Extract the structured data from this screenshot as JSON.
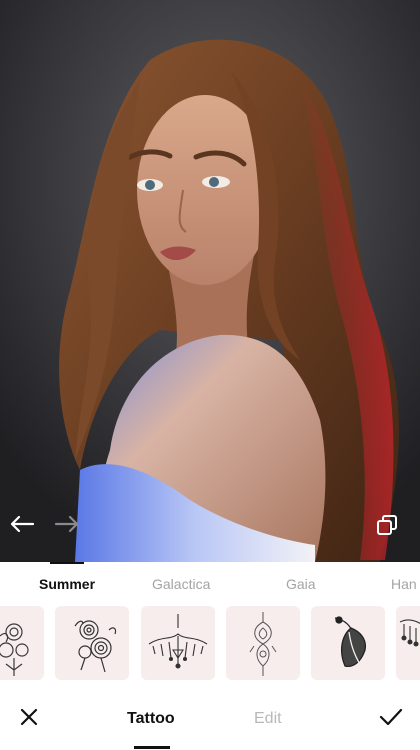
{
  "photo": {
    "undo_icon": "arrow-left-icon",
    "redo_icon": "arrow-right-icon",
    "compare_icon": "compare-copy-icon"
  },
  "categories": [
    {
      "label": "Summer",
      "active": true
    },
    {
      "label": "Galactica",
      "active": false
    },
    {
      "label": "Gaia",
      "active": false
    },
    {
      "label": "Han",
      "active": false
    }
  ],
  "thumbnails": [
    {
      "name": "floral-bouquet-partial"
    },
    {
      "name": "peony-rose-bouquet"
    },
    {
      "name": "ornamental-chandelier"
    },
    {
      "name": "lotus-mandala-drop"
    },
    {
      "name": "feather-dreamcatcher"
    },
    {
      "name": "lace-pendant-partial"
    }
  ],
  "bottom_bar": {
    "close_icon": "close-icon",
    "tattoo_label": "Tattoo",
    "edit_label": "Edit",
    "confirm_icon": "checkmark-icon"
  },
  "colors": {
    "active_text": "#111111",
    "inactive_text": "#a4a4a4",
    "thumb_bg": "#f7eded",
    "rim_light_red": "#c8242c",
    "rim_light_blue": "#5a78e6"
  }
}
